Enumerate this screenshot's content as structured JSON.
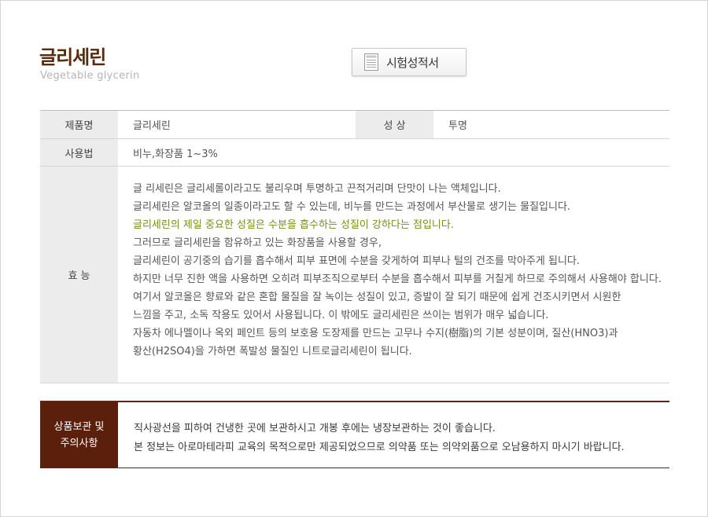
{
  "header": {
    "title": "글리세린",
    "subtitle": "Vegetable glycerin",
    "certificate_button": "시험성적서",
    "certificate_icon": "document-list-icon"
  },
  "info": {
    "product_name_label": "제품명",
    "product_name_value": "글리세린",
    "property_label": "성 상",
    "property_value": "투명",
    "usage_label": "사용법",
    "usage_value": "비누,화장품 1~3%",
    "effect_label": "효 능",
    "effect_lines": [
      "글 리세린은 글리세롤이라고도 불리우며 투명하고 끈적거리며 단맛이 나는 액체입니다.",
      "글리세린은 알코올의 일종이라고도 할 수 있는데, 비누를 만드는 과정에서 부산물로 생기는 물질입니다.",
      "글리세린의 제일 중요한 성질은 수분을 흡수하는 성질이 강하다는 점입니다.",
      "그러므로 글리세린을 함유하고 있는 화장품을 사용할 경우,",
      "글리세린이 공기중의 습기를 흡수해서 피부 표면에 수분을 갖게하여 피부나 털의 건조를 막아주게 됩니다.",
      "하지만 너무 진한 액을 사용하면 오히려 피부조직으로부터 수분을 흡수해서 피부를 거칠게 하므로 주의해서 사용해야 합니다.",
      "여기서 알코올은 향료와 같은 혼합 물질을 잘 녹이는 성질이 있고, 증발이 잘 되기 때문에 쉽게 건조시키면서 시원한",
      "느낌을 주고,  소독 작용도 있어서 사용됩니다. 이 밖에도 글리세린은 쓰이는 범위가 매우 넓습니다.",
      "자동차 에나멜이나 옥외 페인트 등의 보호용 도장제를 만드는 고무나 수지(樹脂)의 기본 성분이며, 질산(HNO3)과",
      "황산(H2SO4)을 가하면 폭발성 물질인 니트로글리세린이 됩니다."
    ],
    "highlight_color": "#7a8c1e"
  },
  "notice": {
    "label_line1": "상품보관 및",
    "label_line2": "주의사항",
    "line1": "직사광선을 피하여 건냉한 곳에 보관하시고 개봉 후에는 냉장보관하는 것이 좋습니다.",
    "line2": "본 정보는 아로마테라피 교육의 목적으로만 제공되었으므로 의약품 또는 의약외품으로 오남용하지 마시기 바랍니다."
  },
  "colors": {
    "title": "#5a2a0c",
    "notice_header_bg": "#5a200c",
    "table_header_bg": "#ececec"
  }
}
